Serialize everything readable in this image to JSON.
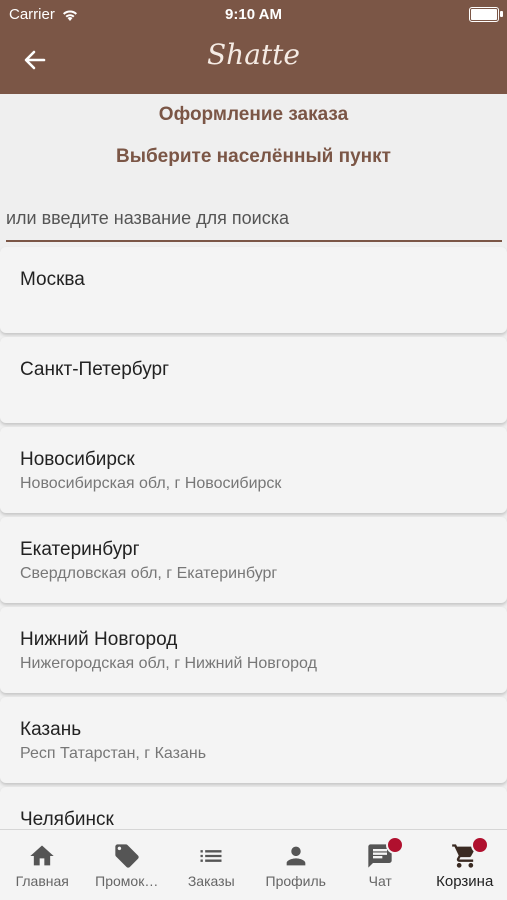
{
  "status": {
    "carrier": "Carrier",
    "time": "9:10 AM"
  },
  "header": {
    "logo": "Shatte"
  },
  "page": {
    "title": "Оформление заказа",
    "subtitle": "Выберите населённый пункт",
    "search_placeholder": "или введите название для поиска"
  },
  "cities": [
    {
      "name": "Москва",
      "region": ""
    },
    {
      "name": "Санкт-Петербург",
      "region": ""
    },
    {
      "name": "Новосибирск",
      "region": "Новосибирская обл, г Новосибирск"
    },
    {
      "name": "Екатеринбург",
      "region": "Свердловская обл, г Екатеринбург"
    },
    {
      "name": "Нижний Новгород",
      "region": "Нижегородская обл, г Нижний Новгород"
    },
    {
      "name": "Казань",
      "region": "Респ Татарстан, г Казань"
    },
    {
      "name": "Челябинск",
      "region": ""
    }
  ],
  "tabs": {
    "home": "Главная",
    "promo": "Промок…",
    "orders": "Заказы",
    "profile": "Профиль",
    "chat": "Чат",
    "cart": "Корзина"
  },
  "colors": {
    "brand": "#7b5646",
    "badge": "#b0102e"
  }
}
